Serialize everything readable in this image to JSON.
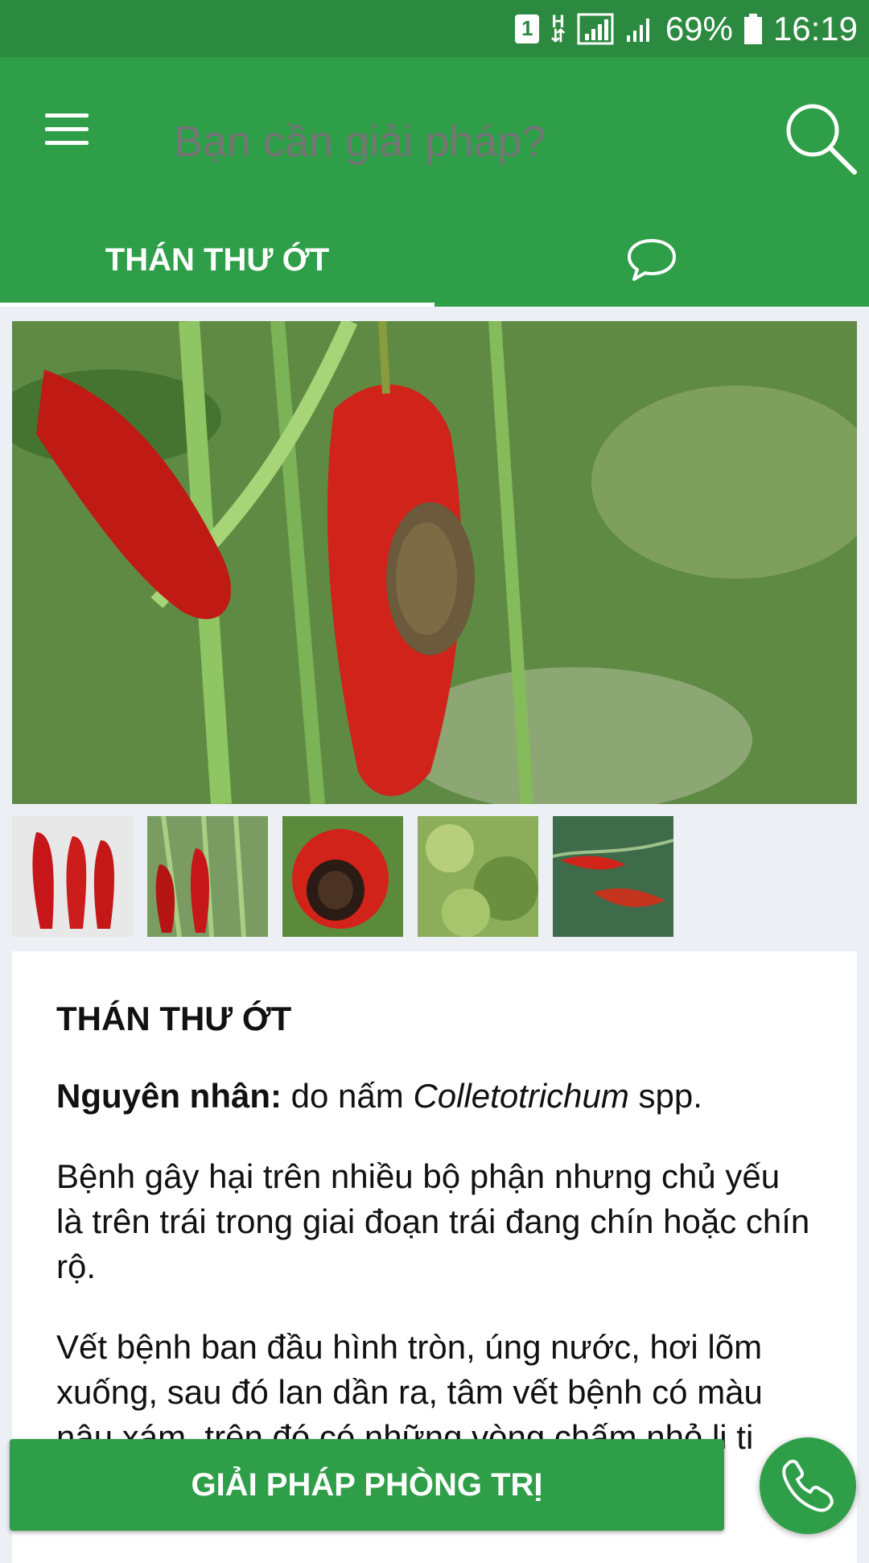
{
  "status_bar": {
    "sim": "1",
    "network": "H",
    "battery": "69%",
    "time": "16:19",
    "icons": [
      "sim-icon",
      "network-h-icon",
      "signal-icon",
      "signal-icon",
      "battery-icon"
    ]
  },
  "header": {
    "search_placeholder": "Bạn cần giải pháp?",
    "menu_icon": "menu-icon",
    "search_icon": "search-icon"
  },
  "tabs": [
    {
      "label": "THÁN THƯ ỚT",
      "active": true
    },
    {
      "icon": "comment-icon",
      "active": false
    }
  ],
  "gallery": {
    "thumbnails": 5
  },
  "article": {
    "title": "THÁN THƯ ỚT",
    "cause_label": "Nguyên nhân:",
    "cause_text": " do nấm ",
    "cause_species": "Colletotrichum",
    "cause_suffix": " spp.",
    "paragraph_1": "Bệnh gây hại trên nhiều bộ phận nhưng chủ yếu là trên trái trong giai đoạn trái đang chín hoặc chín rộ.",
    "paragraph_2": "Vết bệnh ban đầu hình tròn, úng nước, hơi lõm xuống, sau đó lan dần ra, tâm vết bệnh có màu nâu xám, trên đó có những vòng chấm nhỏ li ti màu đen nhô lên cao."
  },
  "actions": {
    "solution_button": "GIẢI PHÁP PHÒNG TRỊ",
    "call_icon": "phone-icon"
  },
  "colors": {
    "primary": "#2e9e48",
    "status_bar": "#2c8a40",
    "background": "#eceff3"
  }
}
